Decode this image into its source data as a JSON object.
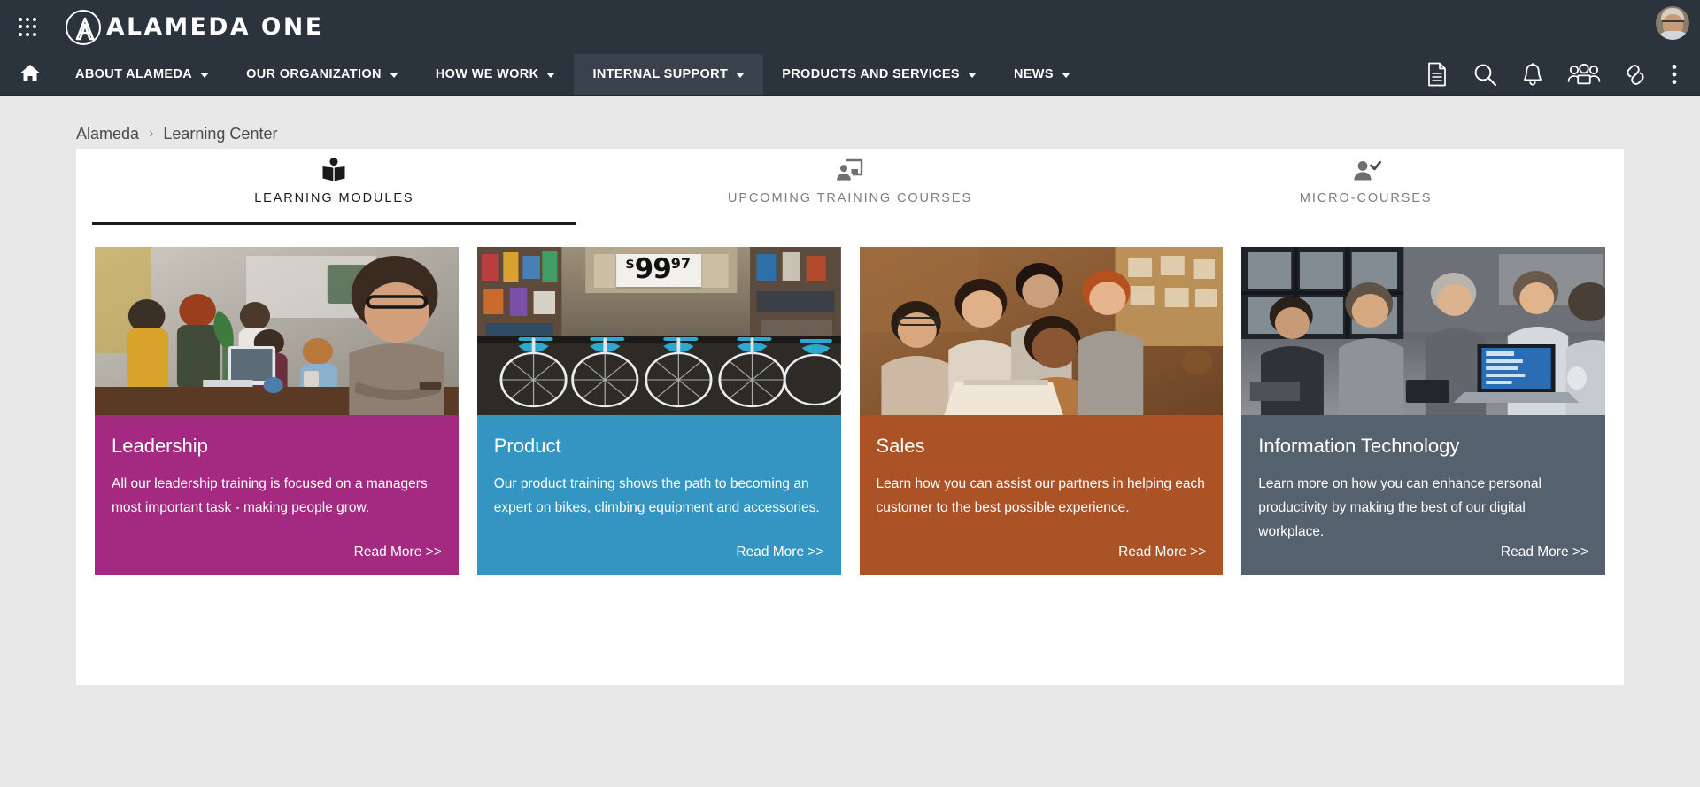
{
  "topbar": {
    "apps_icon": "grid-apps-icon",
    "logo_icon": "alameda-logo-icon",
    "brand": "ALAMEDA ONE",
    "avatar_icon": "user-avatar"
  },
  "nav": {
    "home_icon": "home-icon",
    "items": [
      {
        "label": "ABOUT ALAMEDA",
        "has_caret": true,
        "active": false
      },
      {
        "label": "OUR ORGANIZATION",
        "has_caret": true,
        "active": false
      },
      {
        "label": "HOW WE WORK",
        "has_caret": true,
        "active": false
      },
      {
        "label": "INTERNAL SUPPORT",
        "has_caret": true,
        "active": true
      },
      {
        "label": "PRODUCTS AND SERVICES",
        "has_caret": true,
        "active": false
      },
      {
        "label": "NEWS",
        "has_caret": true,
        "active": false
      }
    ],
    "icons": [
      "document-icon",
      "search-icon",
      "bell-icon",
      "people-icon",
      "link-icon",
      "more-vertical-icon"
    ]
  },
  "breadcrumb": {
    "root": "Alameda",
    "separator": "›",
    "current": "Learning Center"
  },
  "tabs": [
    {
      "label": "LEARNING MODULES",
      "icon": "open-book-icon",
      "active": true
    },
    {
      "label": "UPCOMING TRAINING COURSES",
      "icon": "presenter-screen-icon",
      "active": false
    },
    {
      "label": "MICRO-COURSES",
      "icon": "user-check-icon",
      "active": false
    }
  ],
  "cards": [
    {
      "title": "Leadership",
      "description": "All our leadership training is focused on a managers most important task - making people grow.",
      "read_more": "Read More >>",
      "color": "#a32a80",
      "image_alt": "office-team-meeting-photo"
    },
    {
      "title": "Product",
      "description": "Our product training shows the path to becoming an expert on bikes, climbing equipment and accessories.",
      "read_more": "Read More >>",
      "color": "#3495c2",
      "image_alt": "bicycle-shop-photo",
      "overlay_price": {
        "currency": "$",
        "dollars": "99",
        "cents": "97"
      }
    },
    {
      "title": "Sales",
      "description": "Learn how you can assist our partners in helping each customer to the best possible experience.",
      "read_more": "Read More >>",
      "color": "#ab5226",
      "image_alt": "smiling-colleagues-laptop-photo"
    },
    {
      "title": "Information Technology",
      "description": "Learn more on how you can enhance personal productivity by making the best of our digital workplace.",
      "read_more": "Read More >>",
      "color": "#55626e",
      "image_alt": "office-workers-laptop-photo"
    }
  ],
  "colors": {
    "header_bg": "#2b333c",
    "header_active": "#39424c",
    "page_bg": "#e8e8e8",
    "panel_bg": "#ffffff",
    "tab_active_text": "#1b1b1b",
    "tab_inactive_text": "#7d7d7d"
  }
}
